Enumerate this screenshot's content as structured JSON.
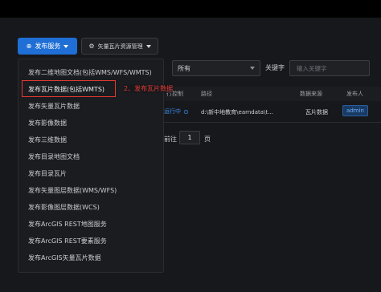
{
  "toolbar": {
    "publish_label": "发布服务",
    "tile_label": "矢量瓦片资源管理"
  },
  "filter": {
    "select_value": "所有",
    "keyword_label": "关键字",
    "keyword_placeholder": "输入关键字"
  },
  "table": {
    "headers": [
      "行控制",
      "路径",
      "数据来源",
      "发布人"
    ],
    "row": {
      "status": "运行中",
      "path": "d:\\新中地教育\\earndata\\t...",
      "source": "瓦片数据",
      "publisher": "admin"
    }
  },
  "pager": {
    "goto_label": "前往",
    "page_value": "1",
    "page_suffix": "页"
  },
  "menu": {
    "items": [
      "发布二维地图文档(包括WMS/WFS/WMTS)",
      "发布瓦片数据(包括WMTS)",
      "发布矢量瓦片数据",
      "发布影像数据",
      "发布三维数据",
      "发布目录地图文档",
      "发布目录瓦片",
      "发布矢量图层数据(WMS/WFS)",
      "发布影像图层数据(WCS)",
      "发布ArcGIS REST地图服务",
      "发布ArcGIS REST要素服务",
      "发布ArcGIS矢量瓦片数据"
    ]
  },
  "annotation": "2、发布瓦片数据",
  "colors": {
    "primary": "#1f6fd6",
    "highlight_border": "#e53935",
    "panel_bg": "#17181b"
  }
}
